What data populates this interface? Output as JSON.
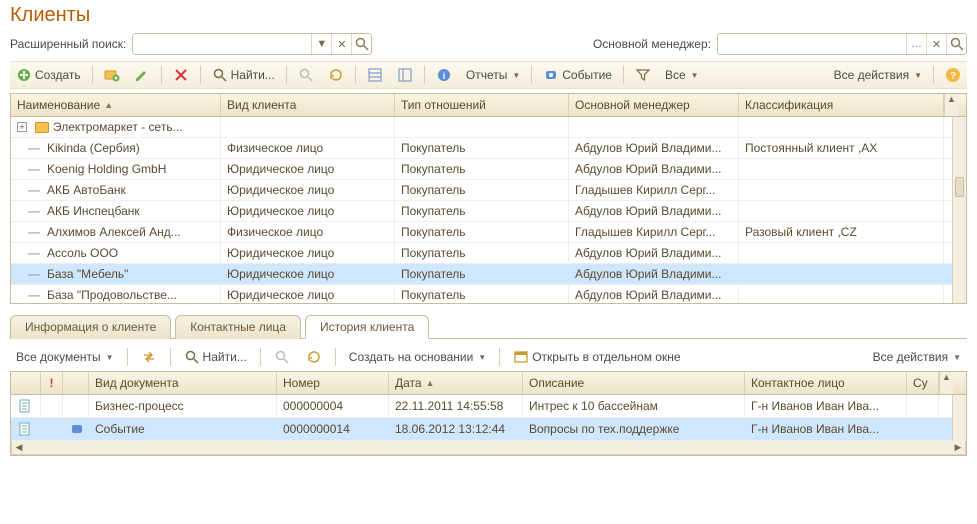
{
  "title": "Клиенты",
  "search": {
    "label": "Расширенный поиск:",
    "value": "",
    "manager_label": "Основной менеджер:",
    "manager_value": ""
  },
  "toolbar": {
    "create": "Создать",
    "find": "Найти...",
    "reports": "Отчеты",
    "event": "Событие",
    "all": "Все",
    "all_actions": "Все действия"
  },
  "main_grid": {
    "columns": [
      "Наименование",
      "Вид клиента",
      "Тип отношений",
      "Основной менеджер",
      "Классификация"
    ],
    "rows": [
      {
        "name": "Электромаркет - сеть...",
        "kind": "",
        "rel": "",
        "mgr": "",
        "cls": "",
        "folder": true
      },
      {
        "name": "Kikinda (Сербия)",
        "kind": "Физическое лицо",
        "rel": "Покупатель",
        "mgr": "Абдулов Юрий Владими...",
        "cls": "Постоянный клиент ,АХ"
      },
      {
        "name": "Koenig Holding GmbH",
        "kind": "Юридическое лицо",
        "rel": "Покупатель",
        "mgr": "Абдулов Юрий Владими...",
        "cls": ""
      },
      {
        "name": "АКБ АвтоБанк",
        "kind": "Юридическое лицо",
        "rel": "Покупатель",
        "mgr": "Гладышев Кирилл Серг...",
        "cls": ""
      },
      {
        "name": "АКБ Инспецбанк",
        "kind": "Юридическое лицо",
        "rel": "Покупатель",
        "mgr": "Абдулов Юрий Владими...",
        "cls": ""
      },
      {
        "name": "Алхимов Алексей Анд...",
        "kind": "Физическое лицо",
        "rel": "Покупатель",
        "mgr": "Гладышев Кирилл Серг...",
        "cls": "Разовый клиент ,CZ"
      },
      {
        "name": "Ассоль ООО",
        "kind": "Юридическое лицо",
        "rel": "Покупатель",
        "mgr": "Абдулов Юрий Владими...",
        "cls": ""
      },
      {
        "name": "База \"Мебель\"",
        "kind": "Юридическое лицо",
        "rel": "Покупатель",
        "mgr": "Абдулов Юрий Владими...",
        "cls": "",
        "selected": true
      },
      {
        "name": "База \"Продовольстве...",
        "kind": "Юридическое лицо",
        "rel": "Покупатель",
        "mgr": "Абдулов Юрий Владими...",
        "cls": ""
      }
    ]
  },
  "tabs": {
    "info": "Информация о клиенте",
    "contacts": "Контактные лица",
    "history": "История клиента"
  },
  "sub_toolbar": {
    "all_docs": "Все документы",
    "find": "Найти...",
    "create_based": "Создать на основании",
    "open_window": "Открыть в отдельном окне",
    "all_actions": "Все действия"
  },
  "history_grid": {
    "columns": [
      "",
      "!",
      "",
      "Вид документа",
      "Номер",
      "Дата",
      "Описание",
      "Контактное лицо",
      "Су"
    ],
    "rows": [
      {
        "kind": "Бизнес-процесс",
        "num": "000000004",
        "date": "22.11.2011 14:55:58",
        "desc": "Интрес к 10 бассейнам",
        "contact": "Г-н Иванов Иван Ива..."
      },
      {
        "kind": "Событие",
        "num": "0000000014",
        "date": "18.06.2012 13:12:44",
        "desc": "Вопросы по тех.поддержке",
        "contact": "Г-н Иванов Иван Ива...",
        "selected": true,
        "icon": true
      }
    ]
  }
}
